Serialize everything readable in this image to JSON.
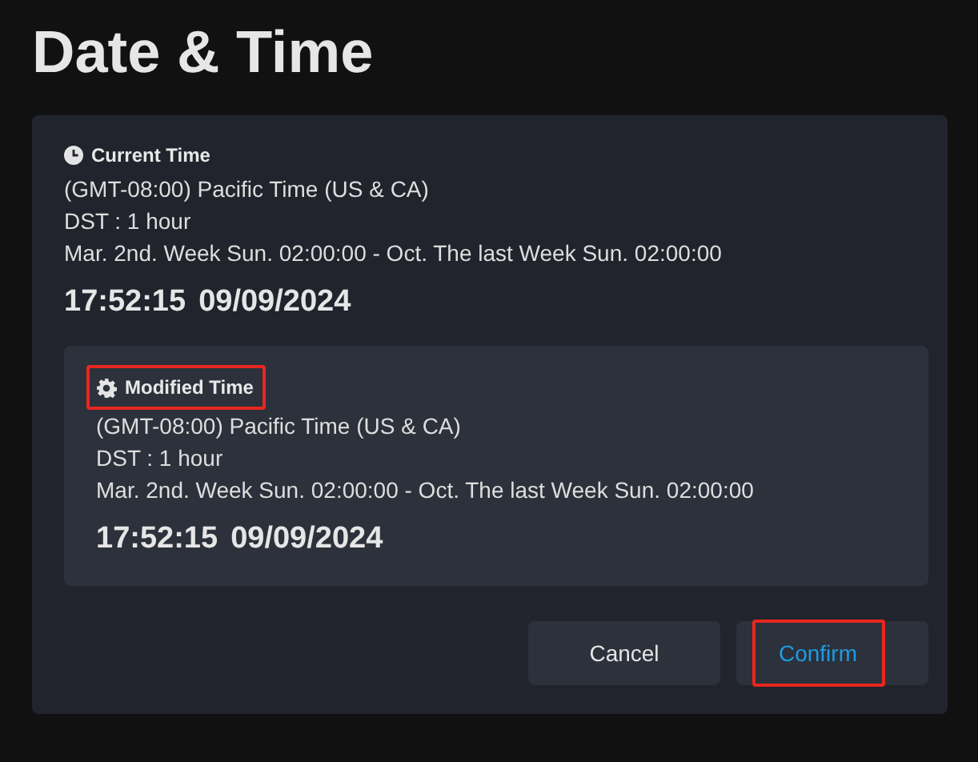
{
  "title": "Date & Time",
  "sections": [
    {
      "kind": "current",
      "heading": "Current Time",
      "highlighted": false,
      "lines": [
        "(GMT-08:00) Pacific Time (US & CA)",
        "DST : 1 hour",
        "Mar. 2nd. Week Sun. 02:00:00 - Oct. The last Week Sun. 02:00:00"
      ],
      "time": "17:52:15",
      "date": "09/09/2024"
    },
    {
      "kind": "modified",
      "heading": "Modified Time",
      "highlighted": true,
      "lines": [
        "(GMT-08:00) Pacific Time (US & CA)",
        "DST : 1 hour",
        "Mar. 2nd. Week Sun. 02:00:00 - Oct. The last Week Sun. 02:00:00"
      ],
      "time": "17:52:15",
      "date": "09/09/2024"
    }
  ],
  "buttons": [
    {
      "label": "Cancel",
      "primary": false,
      "highlighted": false
    },
    {
      "label": "Confirm",
      "primary": true,
      "highlighted": true
    }
  ]
}
